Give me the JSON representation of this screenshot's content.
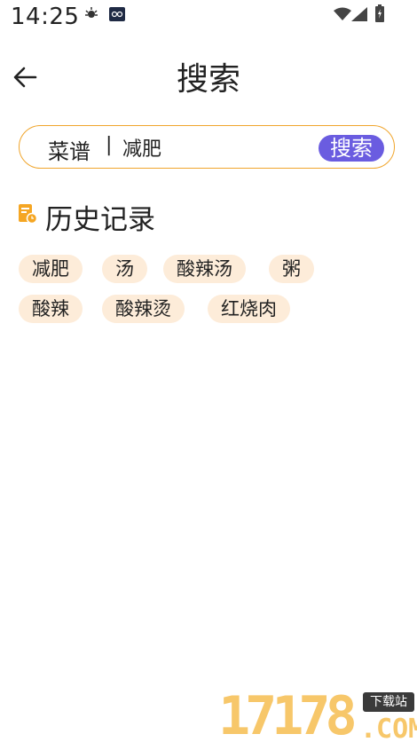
{
  "status_bar": {
    "time": "14:25",
    "icons": [
      "gear-icon",
      "app-notification-icon",
      "wifi-icon",
      "signal-icon",
      "battery-icon"
    ]
  },
  "header": {
    "title": "搜索",
    "back_icon": "arrow-left-icon"
  },
  "search": {
    "category": "菜谱",
    "divider": "|",
    "value": "减肥",
    "button_label": "搜索"
  },
  "history": {
    "title": "历史记录",
    "icon": "history-doc-icon",
    "items": [
      "减肥",
      "汤",
      "酸辣汤",
      "粥",
      "酸辣",
      "酸辣烫",
      "红烧肉"
    ]
  },
  "watermark": {
    "digits": "17178",
    "badge": "下载站",
    "suffix": ".COM"
  },
  "colors": {
    "accent_orange": "#f0a52c",
    "search_button": "#6a5ce0",
    "chip_bg": "#fdecd9",
    "history_icon": "#f5a623"
  }
}
